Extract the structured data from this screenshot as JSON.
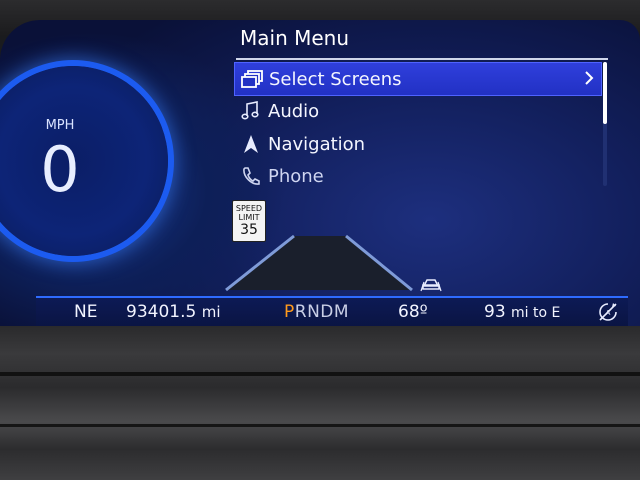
{
  "gauge": {
    "unit": "MPH",
    "speed": "0"
  },
  "menu": {
    "title": "Main Menu",
    "items": [
      {
        "label": "Select Screens",
        "icon": "screens-icon",
        "selected": true
      },
      {
        "label": "Audio",
        "icon": "music-note-icon",
        "selected": false
      },
      {
        "label": "Navigation",
        "icon": "navigation-arrow-icon",
        "selected": false
      },
      {
        "label": "Phone",
        "icon": "phone-icon",
        "selected": false
      }
    ]
  },
  "speed_limit": {
    "line1": "SPEED",
    "line2": "LIMIT",
    "value": "35"
  },
  "status": {
    "heading": "NE",
    "odometer": "93401.5",
    "odometer_unit": "mi",
    "gear_active": "P",
    "gear_rest": "RNDM",
    "temperature": "68º",
    "range": "93",
    "range_unit": "mi to E"
  },
  "colors": {
    "accent_blue": "#2e6bff",
    "menu_selected": "#2231c4",
    "gear_active": "#ff9a1c"
  }
}
